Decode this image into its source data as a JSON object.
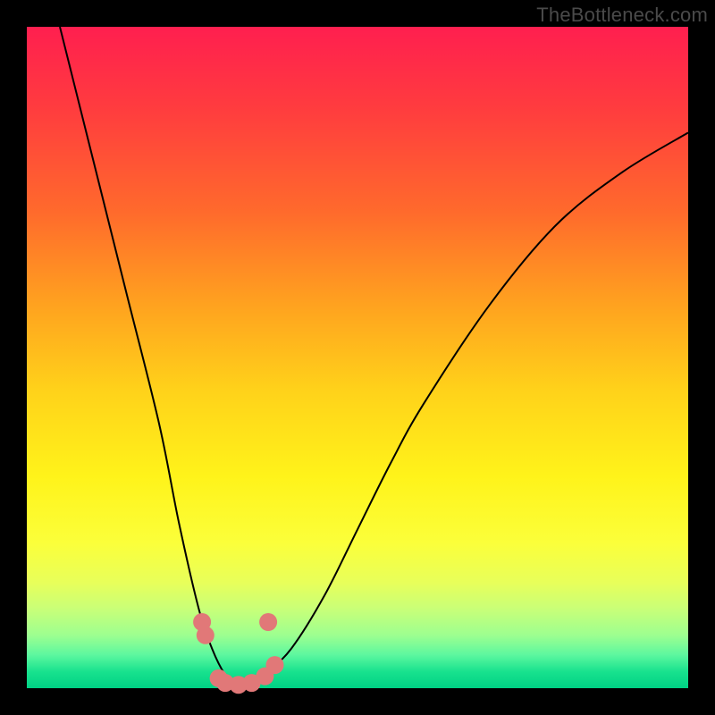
{
  "watermark": "TheBottleneck.com",
  "chart_data": {
    "type": "line",
    "title": "",
    "xlabel": "",
    "ylabel": "",
    "xlim": [
      0,
      100
    ],
    "ylim": [
      0,
      100
    ],
    "series": [
      {
        "name": "bottleneck-curve",
        "x": [
          5,
          10,
          15,
          20,
          23,
          26,
          28,
          30,
          32,
          34,
          36,
          40,
          45,
          50,
          55,
          60,
          70,
          80,
          90,
          100
        ],
        "values": [
          100,
          80,
          60,
          40,
          25,
          12,
          6,
          2,
          0,
          0,
          2,
          6,
          14,
          24,
          34,
          43,
          58,
          70,
          78,
          84
        ]
      }
    ],
    "markers": {
      "name": "highlight-dots",
      "color": "#e17878",
      "points": [
        {
          "x": 26.5,
          "y": 10
        },
        {
          "x": 27.0,
          "y": 8
        },
        {
          "x": 29.0,
          "y": 1.5
        },
        {
          "x": 30.0,
          "y": 0.8
        },
        {
          "x": 32.0,
          "y": 0.5
        },
        {
          "x": 34.0,
          "y": 0.8
        },
        {
          "x": 36.0,
          "y": 1.8
        },
        {
          "x": 37.5,
          "y": 3.5
        },
        {
          "x": 36.5,
          "y": 10
        }
      ]
    },
    "gradient_stops": [
      {
        "pos": 0.0,
        "color": "#ff1f4f"
      },
      {
        "pos": 0.5,
        "color": "#ffe41a"
      },
      {
        "pos": 0.97,
        "color": "#18e28e"
      },
      {
        "pos": 1.0,
        "color": "#00d184"
      }
    ]
  }
}
